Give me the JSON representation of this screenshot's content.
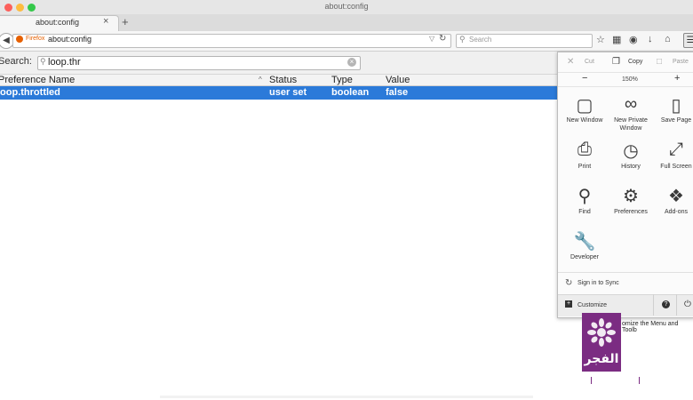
{
  "window": {
    "title": "about:config"
  },
  "tabs": [
    {
      "label": "about:config"
    }
  ],
  "toolbar": {
    "identity_label": "Firefox",
    "url": "about:config",
    "search_placeholder": "Search"
  },
  "config": {
    "search_label": "Search:",
    "search_value": "loop.thr",
    "columns": [
      "Preference Name",
      "Status",
      "Type",
      "Value"
    ],
    "rows": [
      {
        "name": "loop.throttled",
        "status": "user set",
        "type": "boolean",
        "value": "false"
      }
    ]
  },
  "menu_panel": {
    "edit": {
      "cut": "Cut",
      "copy": "Copy",
      "paste": "Paste"
    },
    "zoom": {
      "minus": "−",
      "value": "150%",
      "plus": "+"
    },
    "items": [
      {
        "label": "New Window",
        "icon": "window-icon"
      },
      {
        "label": "New Private Window",
        "icon": "mask-icon"
      },
      {
        "label": "Save Page",
        "icon": "page-icon"
      },
      {
        "label": "Print",
        "icon": "printer-icon"
      },
      {
        "label": "History",
        "icon": "clock-icon"
      },
      {
        "label": "Full Screen",
        "icon": "expand-icon"
      },
      {
        "label": "Find",
        "icon": "magnifier-icon"
      },
      {
        "label": "Preferences",
        "icon": "gear-icon"
      },
      {
        "label": "Add-ons",
        "icon": "puzzle-icon"
      },
      {
        "label": "Developer",
        "icon": "wrench-icon"
      }
    ],
    "sync_label": "Sign in to Sync",
    "customize_label": "Customize",
    "tooltip": "omize the Menu and Toolb"
  },
  "watermark": {
    "text": "الفجر"
  },
  "colors": {
    "selection": "#2b7ad9",
    "firefox_orange": "#e66000",
    "watermark_purple": "#7b2c82"
  }
}
